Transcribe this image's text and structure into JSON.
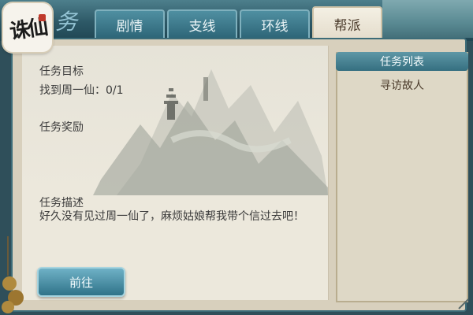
{
  "app": {
    "logo_text": "诛仙",
    "ornament": "务"
  },
  "tabs": [
    {
      "label": "剧情",
      "active": false
    },
    {
      "label": "支线",
      "active": false
    },
    {
      "label": "环线",
      "active": false
    },
    {
      "label": "帮派",
      "active": true
    }
  ],
  "mission": {
    "goal_label": "任务目标",
    "goal_value": "找到周一仙：0/1",
    "reward_label": "任务奖励",
    "desc_label": "任务描述",
    "desc_text": "好久没有见过周一仙了，麻烦姑娘帮我带个信过去吧！"
  },
  "actions": {
    "go_label": "前往"
  },
  "task_list": {
    "title": "任务列表",
    "items": [
      "寻访故人"
    ]
  },
  "colors": {
    "accent": "#2e6678",
    "panel": "#ece8dc",
    "active_tab": "#f4f0e4"
  }
}
